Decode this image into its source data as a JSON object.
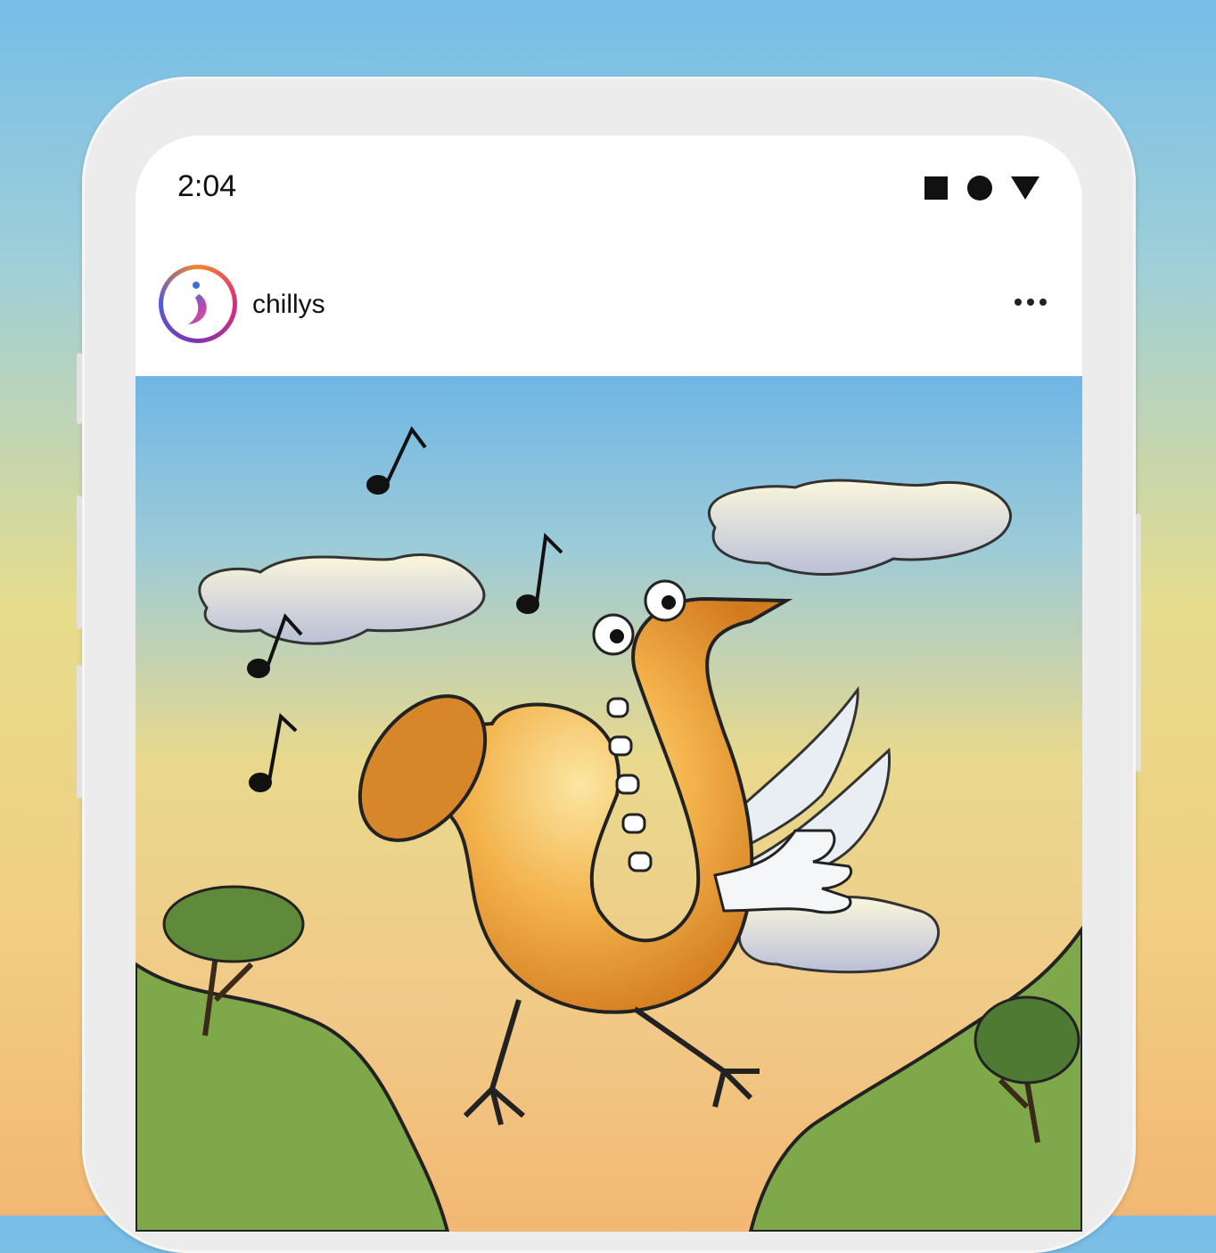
{
  "status_bar": {
    "time": "2:04",
    "icons": [
      "square-icon",
      "circle-icon",
      "triangle-icon"
    ]
  },
  "post": {
    "username": "chillys",
    "avatar_icon": "chillys-logo-icon",
    "menu_icon": "more-options-icon",
    "image_description_icon": "illustration-saxophone-bird"
  },
  "colors": {
    "sky_top": "#6fb6e6",
    "sky_bottom": "#f2b873",
    "hill_green": "#7fa84a"
  }
}
